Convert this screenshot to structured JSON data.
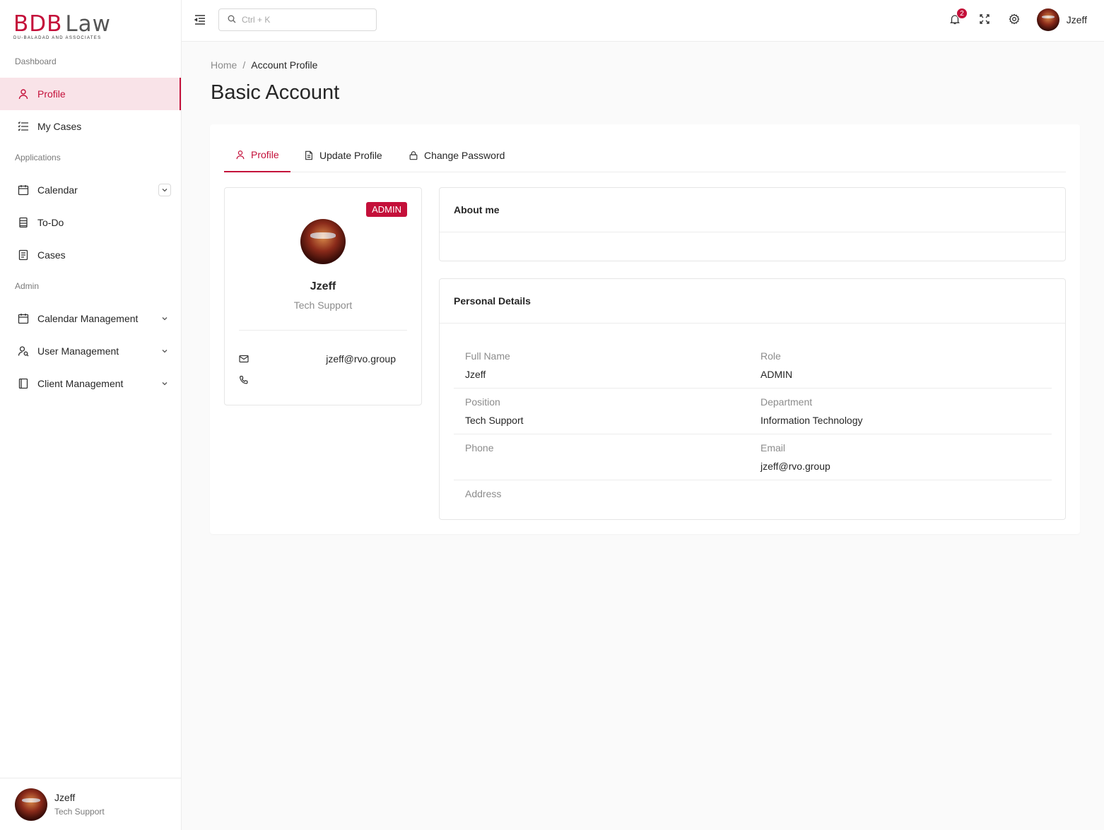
{
  "logo": {
    "brand": "BDB",
    "word": "Law",
    "tagline": "DU-BALADAD AND ASSOCIATES"
  },
  "sidebar": {
    "sections": {
      "dashboard": "Dashboard",
      "applications": "Applications",
      "admin": "Admin"
    },
    "items": [
      {
        "label": "Profile",
        "icon": "user-icon",
        "active": true
      },
      {
        "label": "My Cases",
        "icon": "list-icon"
      },
      {
        "label": "Calendar",
        "icon": "calendar-icon"
      },
      {
        "label": "To-Do",
        "icon": "todo-icon"
      },
      {
        "label": "Cases",
        "icon": "document-icon"
      },
      {
        "label": "Calendar Management",
        "icon": "calendar-icon"
      },
      {
        "label": "User Management",
        "icon": "users-icon"
      },
      {
        "label": "Client Management",
        "icon": "book-icon"
      }
    ],
    "footer_user": {
      "name": "Jzeff",
      "role": "Tech Support"
    }
  },
  "header": {
    "search_placeholder": "Ctrl + K",
    "notification_count": "2",
    "user_name": "Jzeff"
  },
  "breadcrumb": {
    "home": "Home",
    "separator": "/",
    "current": "Account Profile"
  },
  "page_title": "Basic Account",
  "tabs": [
    {
      "label": "Profile",
      "icon": "user-icon",
      "active": true
    },
    {
      "label": "Update Profile",
      "icon": "file-icon"
    },
    {
      "label": "Change Password",
      "icon": "lock-icon"
    }
  ],
  "profile_card": {
    "role_tag": "ADMIN",
    "name": "Jzeff",
    "position": "Tech Support",
    "email": "jzeff@rvo.group",
    "phone": ""
  },
  "about": {
    "title": "About me",
    "text": ""
  },
  "personal_details": {
    "title": "Personal Details",
    "fields": {
      "full_name": {
        "label": "Full Name",
        "value": "Jzeff"
      },
      "role": {
        "label": "Role",
        "value": "ADMIN"
      },
      "position": {
        "label": "Position",
        "value": "Tech Support"
      },
      "department": {
        "label": "Department",
        "value": "Information Technology"
      },
      "phone": {
        "label": "Phone",
        "value": ""
      },
      "email": {
        "label": "Email",
        "value": "jzeff@rvo.group"
      },
      "address": {
        "label": "Address",
        "value": ""
      }
    }
  },
  "colors": {
    "accent": "#c4103a",
    "active_bg": "#f9e3e8"
  }
}
